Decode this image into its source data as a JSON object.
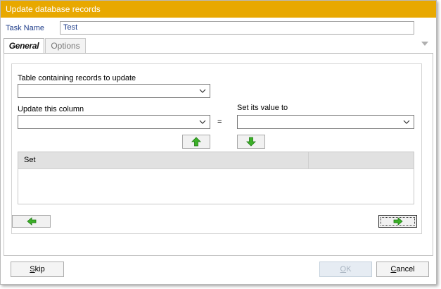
{
  "window": {
    "title": "Update database records"
  },
  "task": {
    "label": "Task Name",
    "value": "Test"
  },
  "tabs": [
    {
      "label": "General"
    },
    {
      "label": "Options"
    }
  ],
  "general": {
    "table_label": "Table containing records to update",
    "table_value": "",
    "column_label": "Update this column",
    "column_value": "",
    "equals": "=",
    "set_value_label": "Set its value to",
    "set_value_value": ""
  },
  "grid": {
    "columns": [
      "Set",
      ""
    ]
  },
  "footer": {
    "skip_label_underlined": "S",
    "skip_label_rest": "kip",
    "ok_label_underlined": "O",
    "ok_label_rest": "K",
    "cancel_label_pre": "",
    "cancel_label_underlined": "C",
    "cancel_label_rest": "ancel"
  },
  "icons": {
    "arrow_up": "arrow-up-icon",
    "arrow_down": "arrow-down-icon",
    "arrow_left": "arrow-left-icon",
    "arrow_right": "arrow-right-icon",
    "chevron": "chevron-down-icon"
  },
  "colors": {
    "titlebar": "#e8a800",
    "arrow_green": "#3cb028",
    "label_blue": "#1f3d8a"
  }
}
